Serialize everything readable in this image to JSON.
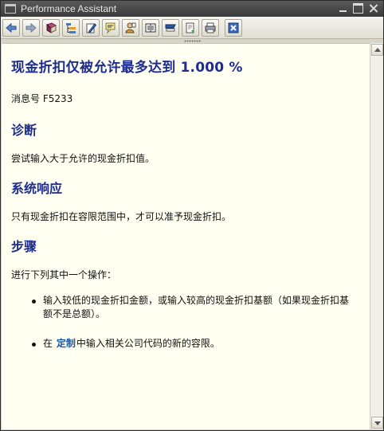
{
  "window": {
    "title": "Performance Assistant",
    "icons": {
      "title": "window-icon",
      "minimize": "minimize-icon",
      "maximize": "maximize-icon",
      "close": "close-icon"
    }
  },
  "toolbar": {
    "buttons": [
      {
        "name": "back-button",
        "icon": "arrow-left-icon"
      },
      {
        "name": "forward-button",
        "icon": "arrow-right-icon"
      },
      {
        "name": "book-button",
        "icon": "book-icon"
      },
      {
        "name": "structure-button",
        "icon": "hierarchy-icon"
      },
      {
        "name": "edit-button",
        "icon": "pencil-icon"
      },
      {
        "name": "glossary-button",
        "icon": "speech-icon"
      },
      {
        "name": "user-button",
        "icon": "person-icon"
      },
      {
        "name": "notes-button",
        "icon": "notebook-icon"
      },
      {
        "name": "flag-button",
        "icon": "flag-icon"
      },
      {
        "name": "export-button",
        "icon": "document-icon"
      },
      {
        "name": "print-button",
        "icon": "printer-icon"
      },
      {
        "name": "close-help-button",
        "icon": "close-box-icon"
      }
    ]
  },
  "doc": {
    "title": "现金折扣仅被允许最多达到 1.000 %",
    "message_number": "消息号 F5233",
    "sections": [
      {
        "heading": "诊断",
        "body": "尝试输入大于允许的现金折扣值。"
      },
      {
        "heading": "系统响应",
        "body": "只有现金折扣在容限范围中，才可以准予现金折扣。"
      },
      {
        "heading": "步骤",
        "body": "进行下列其中一个操作："
      }
    ],
    "bullets": [
      {
        "text": "输入较低的现金折扣金额，或输入较高的现金折扣基额（如果现金折扣基额不是总额）。"
      },
      {
        "prefix": "在",
        "link": "定制",
        "suffix": "中输入相关公司代码的新的容限。"
      }
    ]
  },
  "colors": {
    "heading": "#1E2D8F",
    "link": "#1A56A8",
    "content_bg": "#FFFFF2",
    "titlebar": "#3A3A3A"
  }
}
